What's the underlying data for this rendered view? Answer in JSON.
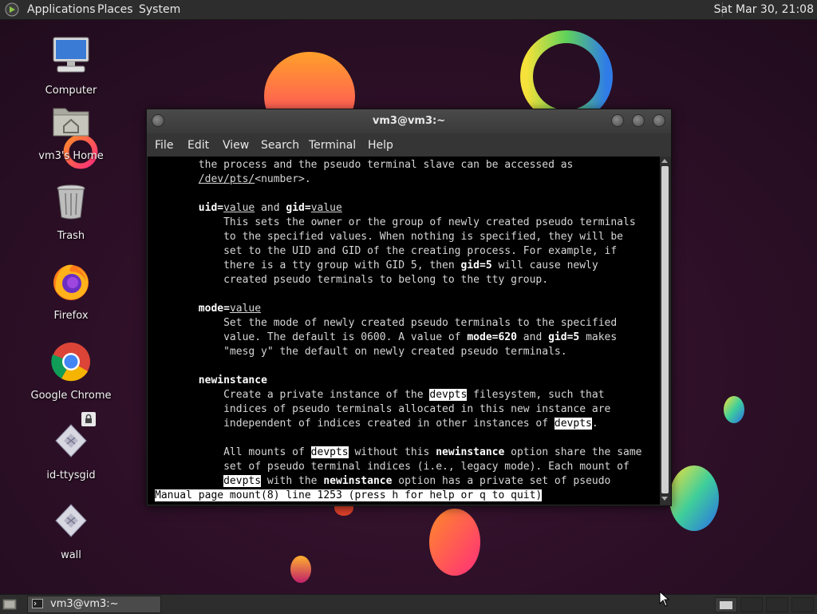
{
  "top_panel": {
    "menus": [
      "Applications",
      "Places",
      "System"
    ],
    "clock": "Sat Mar 30, 21:08"
  },
  "desktop_icons": [
    "Computer",
    "vm3's Home",
    "Trash",
    "Firefox",
    "Google Chrome",
    "id-ttysgid",
    "wall"
  ],
  "terminal": {
    "title": "vm3@vm3:~",
    "menu": [
      "File",
      "Edit",
      "View",
      "Search",
      "Terminal",
      "Help"
    ],
    "status_line": "Manual page mount(8) line 1253 (press h for help or q to quit)"
  },
  "taskbar": {
    "task_label": "vm3@vm3:~"
  },
  "colors": {
    "background": "#2a1024",
    "panel": "#2d2d2d",
    "terminal_bg": "#000000"
  }
}
